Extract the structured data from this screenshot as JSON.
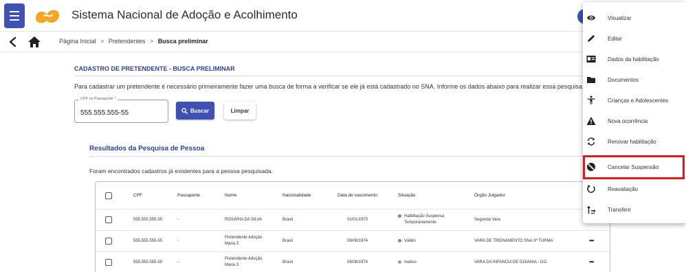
{
  "appbar": {
    "title": "Sistema Nacional de Adoção e Acolhimento",
    "colors": {
      "primary": "#3f51b5",
      "logo_orange": "#f5a623"
    }
  },
  "breadcrumb": {
    "items": [
      "Página Inicial",
      "Pretendentes",
      "Busca preliminar"
    ],
    "separator": ">"
  },
  "main": {
    "section_title": "CADASTRO DE PRETENDENTE - BUSCA PRELIMINAR",
    "info_text": "Para cadastrar um pretendente é necessário primeiramente fazer uma busca de forma a verificar se ele já está cadastrado no SNA. Informe os dados abaixo para realizar essa pesquisa.",
    "cpf_field": {
      "label": "CPF ou Passaporte *",
      "value": "555.555.555-55"
    },
    "search_button": "Buscar",
    "clear_button": "Limpar",
    "results_title": "Resultados da Pesquisa de Pessoa",
    "results_message": "Foram encontrados cadastros já existentes para a pessoa pesquisada."
  },
  "table": {
    "headers": {
      "cpf": "CPF",
      "passaporte": "Passaporte",
      "nome": "Nome",
      "nacionalidade": "Nacionalidade",
      "data_nascimento": "Data de nascimento",
      "situacao": "Situação",
      "orgao": "Órgão Julgador"
    },
    "rows": [
      {
        "cpf": "555.555.555-55",
        "passaporte": "-",
        "nome": "ROSÁRIA DA SILVA",
        "nacionalidade": "Brasil",
        "data": "01/01/1970",
        "situacao": "Habilitação Suspensa Temporariamente",
        "status_color": "#4caf50",
        "orgao": "Segunda Vara",
        "actions": "•••"
      },
      {
        "cpf": "555.555.555-55",
        "passaporte": "-",
        "nome": "Pretendente Adoção Maria 3",
        "nacionalidade": "Brasil",
        "data": "08/08/1974",
        "situacao": "Válido",
        "status_color": "#4caf50",
        "orgao": "VARA DE TREINAMENTO SNA 3ª TURMA",
        "actions": "•••"
      },
      {
        "cpf": "555.555.555-55",
        "passaporte": "-",
        "nome": "Pretendente Adoção Maria 3",
        "nacionalidade": "Brasil",
        "data": "08/08/1974",
        "situacao": "Inativo",
        "status_color": "#9e9e9e",
        "orgao": "VARA DA INFANCIA DE GOIANIA - GO",
        "actions": "•••"
      }
    ]
  },
  "context_menu": {
    "items": [
      {
        "label": "Visualizar",
        "icon": "eye-icon"
      },
      {
        "label": "Editar",
        "icon": "pencil-icon"
      },
      {
        "label": "Dados da habilitação",
        "icon": "id-card-icon"
      },
      {
        "label": "Documentos",
        "icon": "folder-icon"
      },
      {
        "label": "Crianças e Adolescentes",
        "icon": "child-icon"
      },
      {
        "label": "Nova ocorrência",
        "icon": "warning-icon"
      },
      {
        "label": "Renovar habilitação",
        "icon": "renew-icon"
      },
      {
        "label": "Cancelar Suspensão",
        "icon": "cancel-suspension-icon",
        "highlighted": true,
        "highlight_color": "#e8151b"
      },
      {
        "label": "Reavaliação",
        "icon": "reevaluate-icon"
      },
      {
        "label": "Transferir",
        "icon": "transfer-icon"
      }
    ]
  }
}
